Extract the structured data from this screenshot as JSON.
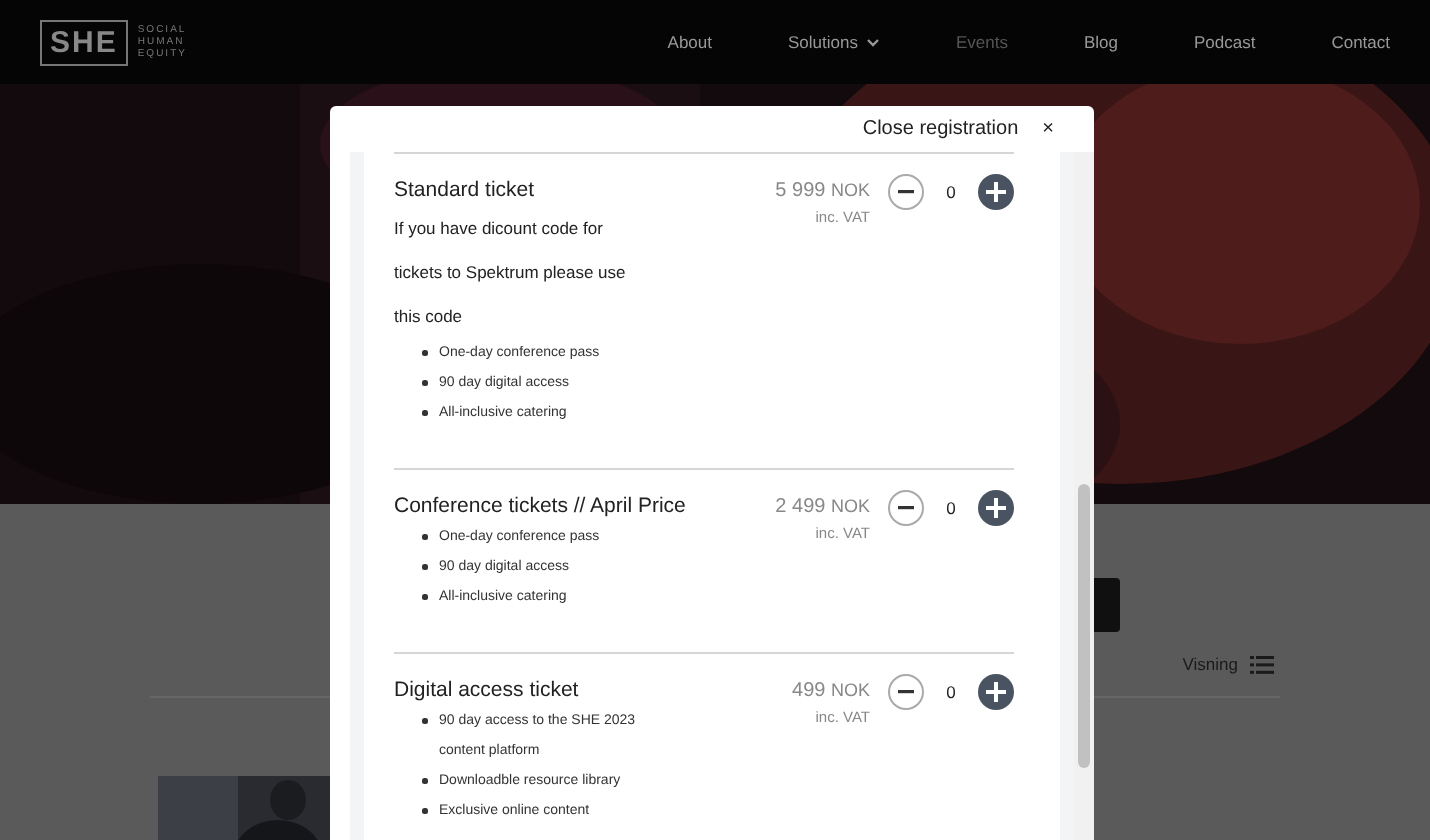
{
  "site": {
    "logo": "SHE",
    "tagline": [
      "SOCIAL",
      "HUMAN",
      "EQUITY"
    ],
    "nav": [
      {
        "label": "About",
        "selected": false,
        "has_menu": false
      },
      {
        "label": "Solutions",
        "selected": false,
        "has_menu": true
      },
      {
        "label": "Events",
        "selected": true,
        "has_menu": false
      },
      {
        "label": "Blog",
        "selected": false,
        "has_menu": false
      },
      {
        "label": "Podcast",
        "selected": false,
        "has_menu": false
      },
      {
        "label": "Contact",
        "selected": false,
        "has_menu": false
      }
    ]
  },
  "listing": {
    "view_label": "Visning"
  },
  "modal": {
    "close_label": "Close registration",
    "close_icon": "×",
    "tickets": [
      {
        "name": "Standard ticket",
        "description": "If you have dicount code for tickets to Spektrum please use this code",
        "price": "5 999",
        "currency": "NOK",
        "vat": "inc. VAT",
        "quantity": "0",
        "features": [
          "One-day conference pass",
          "90 day digital access",
          "All-inclusive catering"
        ]
      },
      {
        "name": "Conference tickets // April Price",
        "price": "2 499",
        "currency": "NOK",
        "vat": "inc. VAT",
        "quantity": "0",
        "features": [
          "One-day conference pass",
          "90 day digital access",
          "All-inclusive catering"
        ]
      },
      {
        "name": "Digital access ticket",
        "price": "499",
        "currency": "NOK",
        "vat": "inc. VAT",
        "quantity": "0",
        "features": [
          "90 day access to the SHE 2023 content platform",
          "Downloadble resource library",
          "Exclusive online content"
        ]
      }
    ]
  }
}
